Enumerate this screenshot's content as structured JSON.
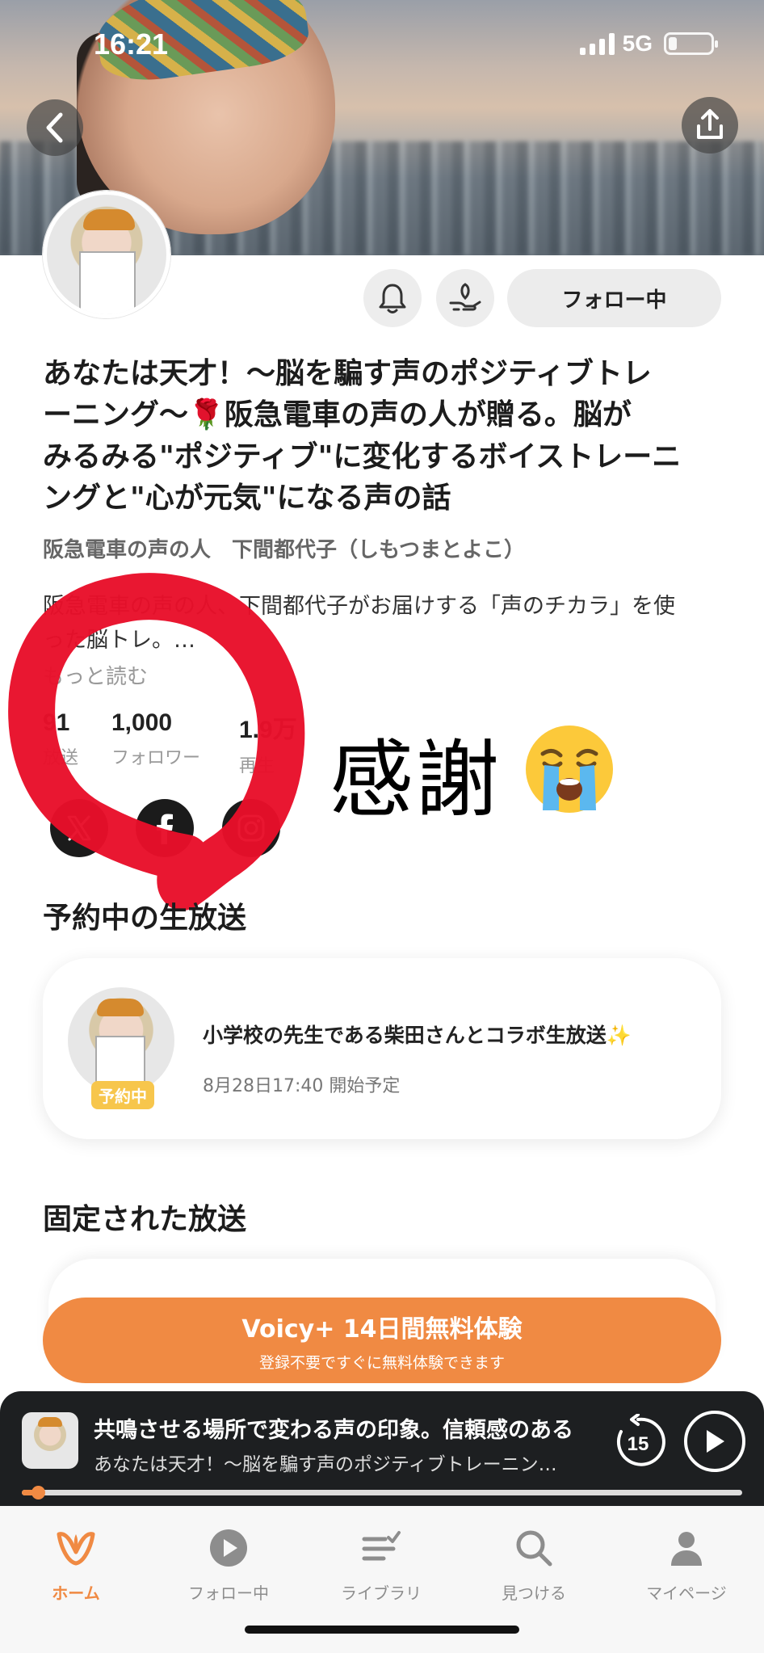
{
  "status_bar": {
    "time": "16:21",
    "network": "5G"
  },
  "header": {
    "back_icon": "chevron-left-icon",
    "share_icon": "share-icon"
  },
  "profile": {
    "follow_label": "フォロー中",
    "bell_icon": "bell-icon",
    "gift_icon": "gift-hand-icon",
    "title_lines": [
      "あなたは天才！〜脳を騙す声のポジティブトレ",
      "ーニング〜🌹阪急電車の声の人が贈る。脳が",
      "みるみる\"ポジティブ\"に変化するボイストレーニ",
      "ングと\"心が元気\"になる声の話"
    ],
    "author": "阪急電車の声の人　下間都代子（しもつまとよこ）",
    "description_lines": [
      "阪急電車の声の人、下間都代子がお届けする「声のチカラ」を使",
      "った脳トレ。…"
    ],
    "more_label": "もっと読む",
    "stats": [
      {
        "value": "91",
        "label": "放送"
      },
      {
        "value": "1,000",
        "label": "フォロワー"
      },
      {
        "value": "1.9万",
        "label": "再生"
      }
    ],
    "social": [
      {
        "name": "x",
        "color": "#1b1b1b"
      },
      {
        "name": "facebook",
        "color": "#1b1b1b"
      },
      {
        "name": "instagram",
        "color": "#1b1b1b"
      }
    ]
  },
  "annotation": {
    "text": "感謝",
    "emoji": "😭",
    "marker_color": "#e8102a"
  },
  "live_section": {
    "title": "予約中の生放送",
    "card": {
      "badge": "予約中",
      "title": "小学校の先生である柴田さんとコラボ生放送✨",
      "time": "8月28日17:40 開始予定"
    }
  },
  "pinned_section": {
    "title": "固定された放送"
  },
  "promo": {
    "main": "Voicy+ 14日間無料体験",
    "sub": "登録不要ですぐに無料体験できます",
    "color": "#f08a43"
  },
  "player": {
    "title": "共鳴させる場所で変わる声の印象。信頼感のある",
    "subtitle": "あなたは天才！〜脳を騙す声のポジティブトレーニン…",
    "skip_seconds": "15",
    "progress": 0.02
  },
  "tabbar": {
    "accent": "#f08a43",
    "items": [
      {
        "label": "ホーム",
        "icon": "voicy-logo-icon",
        "active": true
      },
      {
        "label": "フォロー中",
        "icon": "play-circle-icon",
        "active": false
      },
      {
        "label": "ライブラリ",
        "icon": "library-list-icon",
        "active": false
      },
      {
        "label": "見つける",
        "icon": "search-icon",
        "active": false
      },
      {
        "label": "マイページ",
        "icon": "person-icon",
        "active": false
      }
    ]
  }
}
